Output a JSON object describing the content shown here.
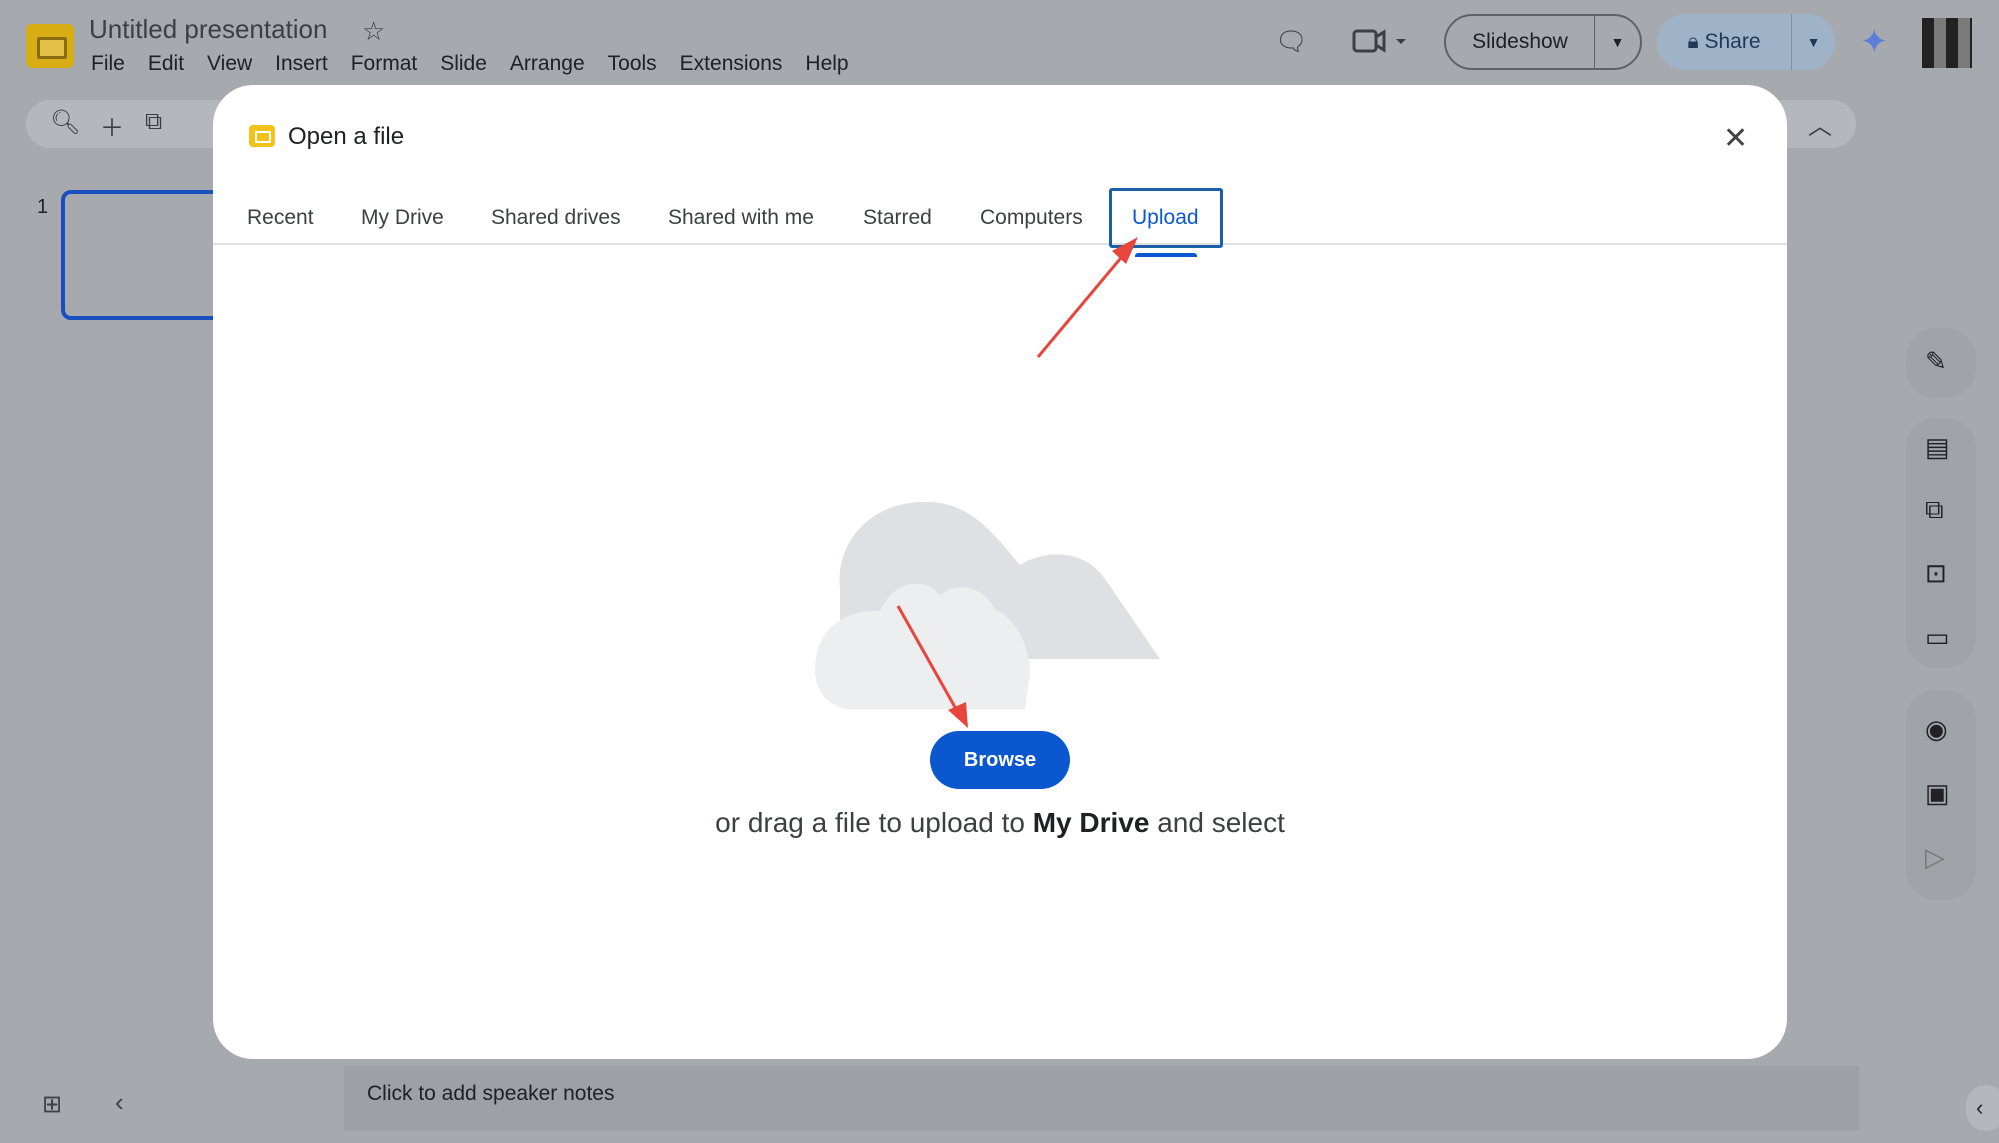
{
  "app": {
    "title": "Untitled presentation",
    "menu": [
      "File",
      "Edit",
      "View",
      "Insert",
      "Format",
      "Slide",
      "Arrange",
      "Tools",
      "Extensions",
      "Help"
    ],
    "slideshow_label": "Slideshow",
    "share_label": "Share"
  },
  "slides": {
    "number": "1"
  },
  "notes": {
    "placeholder": "Click to add speaker notes"
  },
  "dialog": {
    "title": "Open a file",
    "tabs": [
      "Recent",
      "My Drive",
      "Shared drives",
      "Shared with me",
      "Starred",
      "Computers",
      "Upload"
    ],
    "active_tab": "Upload",
    "browse_label": "Browse",
    "drag_text_pre": "or drag a file to upload to ",
    "drag_text_bold": "My Drive",
    "drag_text_post": " and select"
  },
  "colors": {
    "accent": "#0b57d0",
    "annotation_arrow": "#e8453c",
    "highlight_box": "#1a5fa8"
  },
  "icons": [
    "search-icon",
    "plus-icon",
    "new-slide-icon",
    "comment-icon",
    "camera-icon",
    "lock-icon",
    "gemini-icon",
    "close-icon",
    "cloud-illustration",
    "grid-icon",
    "chevron-left-icon"
  ]
}
